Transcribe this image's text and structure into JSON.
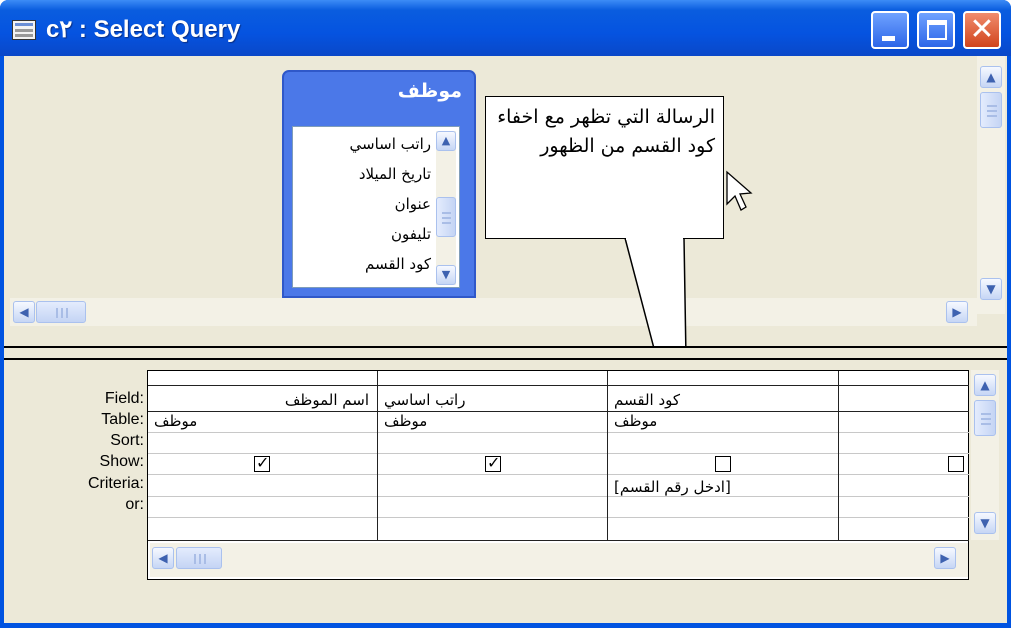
{
  "window": {
    "title": "c٢ : Select Query",
    "title_bar_color": "#0a5ddf",
    "buttons": {
      "minimize_icon": "minimize-icon",
      "maximize_icon": "maximize-icon",
      "close_icon": "close-icon"
    }
  },
  "table_window": {
    "title": "موظف",
    "fields": [
      "راتب اساسي",
      "تاريخ الميلاد",
      "عنوان",
      "تليفون",
      "كود القسم"
    ]
  },
  "callout": {
    "text": "الرسالة التي تظهر مع اخفاء كود القسم من الظهور"
  },
  "grid": {
    "row_labels": [
      "Field:",
      "Table:",
      "Sort:",
      "Show:",
      "Criteria:",
      "or:"
    ],
    "columns": [
      {
        "field": "اسم الموظف",
        "table": "موظف",
        "sort": "",
        "show": true,
        "criteria": "",
        "or": ""
      },
      {
        "field": "راتب اساسي",
        "table": "موظف",
        "sort": "",
        "show": true,
        "criteria": "",
        "or": ""
      },
      {
        "field": "كود القسم",
        "table": "موظف",
        "sort": "",
        "show": false,
        "criteria": "[ادخل رقم القسم]",
        "or": ""
      },
      {
        "field": "",
        "table": "",
        "sort": "",
        "show": false,
        "criteria": "",
        "or": ""
      }
    ]
  }
}
